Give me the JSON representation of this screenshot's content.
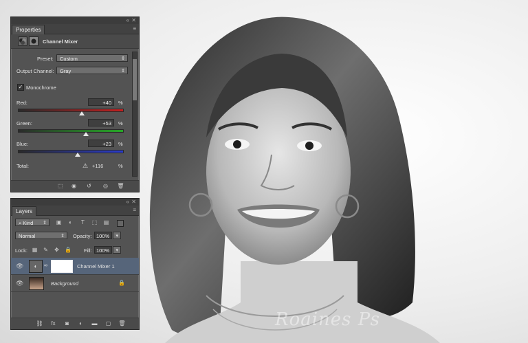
{
  "properties": {
    "tab_label": "Properties",
    "adjustment_title": "Channel Mixer",
    "preset_label": "Preset:",
    "preset_value": "Custom",
    "output_channel_label": "Output Channel:",
    "output_channel_value": "Gray",
    "monochrome_label": "Monochrome",
    "monochrome_checked": true,
    "red_label": "Red:",
    "red_value": "+40",
    "red_level_percent": 40,
    "green_label": "Green:",
    "green_value": "+53",
    "green_level_percent": 53,
    "blue_label": "Blue:",
    "blue_value": "+23",
    "blue_level_percent": 23,
    "total_label": "Total:",
    "total_value": "+116",
    "percent": "%"
  },
  "layers": {
    "tab_label": "Layers",
    "filter_kind": "Kind",
    "blend_mode": "Normal",
    "opacity_label": "Opacity:",
    "opacity_value": "100%",
    "lock_label": "Lock:",
    "fill_label": "Fill:",
    "fill_value": "100%",
    "items": [
      {
        "name": "Channel Mixer 1",
        "selected": true
      },
      {
        "name": "Background",
        "selected": false
      }
    ]
  },
  "watermark": "Roaines Ps",
  "colors": {
    "panel_bg": "#535353",
    "selected_layer": "#56657a",
    "red_slider": "#c42020",
    "green_slider": "#26a626",
    "blue_slider": "#2a3bcc"
  }
}
